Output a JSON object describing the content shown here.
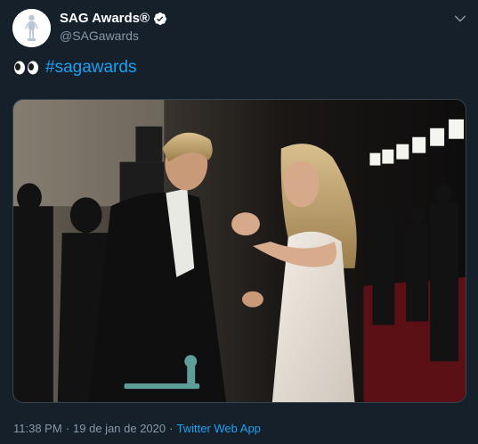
{
  "tweet": {
    "display_name": "SAG Awards®",
    "handle": "@SAGawards",
    "text_emoji": "eyes-icon",
    "hashtag": "#sagawards",
    "time": "11:38 PM",
    "separator": "·",
    "date": "19 de jan de 2020",
    "source_separator": "·",
    "source": "Twitter Web App"
  },
  "icons": {
    "avatar": "sag-statue-logo",
    "verified": "verified-badge-icon",
    "menu": "chevron-down-icon"
  },
  "colors": {
    "background": "#15202b",
    "text": "#ffffff",
    "secondary_text": "#8899a6",
    "link": "#1da1f2"
  }
}
